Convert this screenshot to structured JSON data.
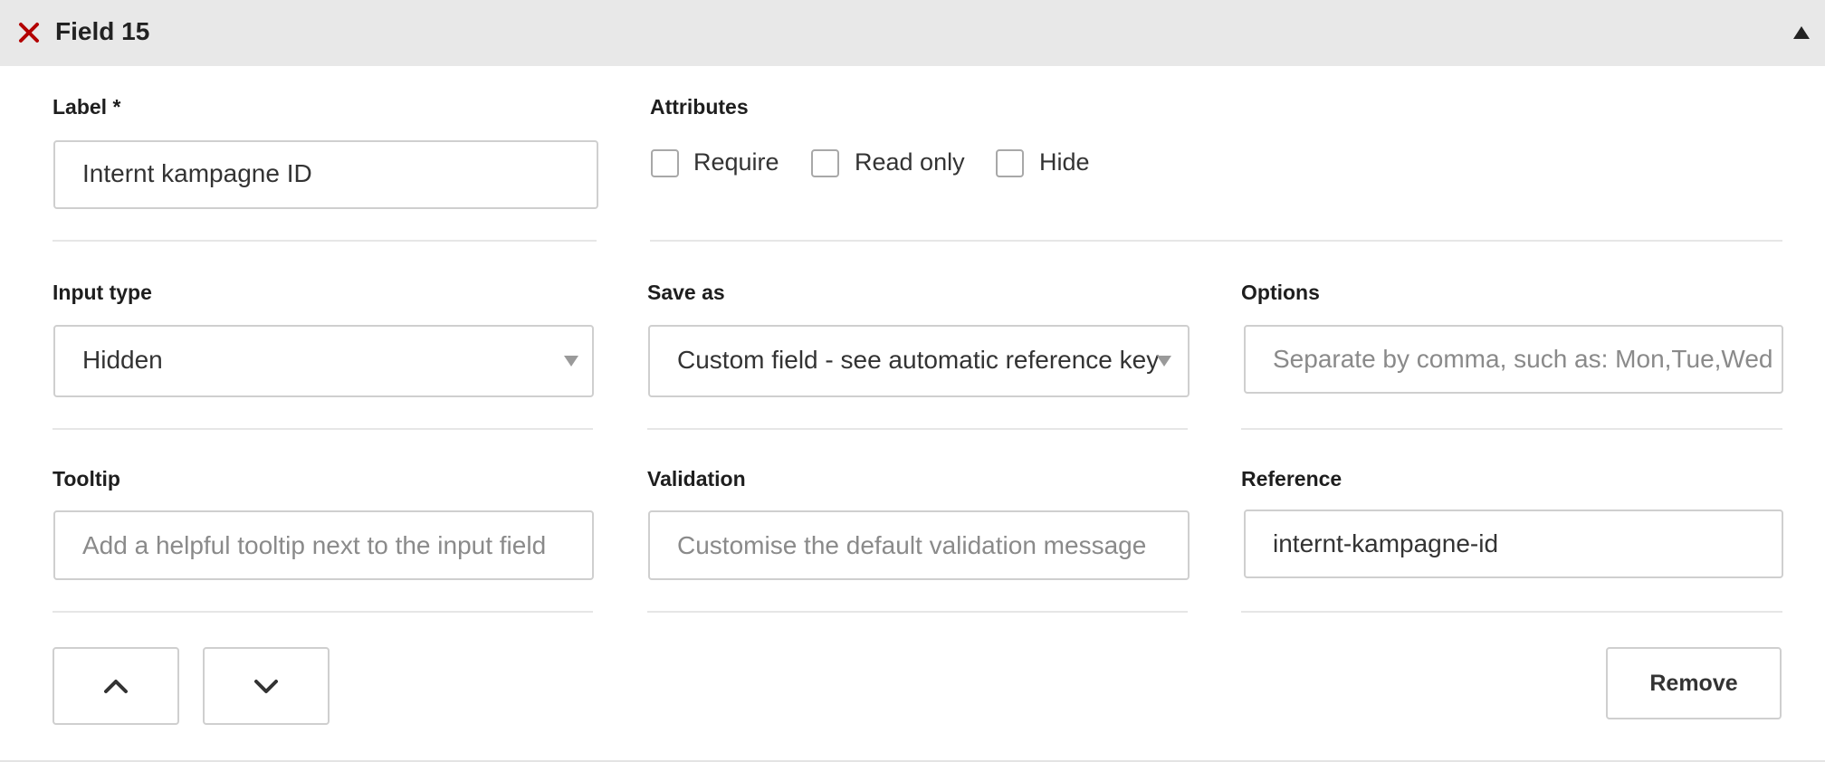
{
  "header": {
    "title": "Field 15",
    "close_icon": "close-x-icon",
    "collapse_icon": "triangle-up-icon",
    "accent_color": "#b30000"
  },
  "label_field": {
    "label": "Label *",
    "value": "Internt kampagne ID"
  },
  "attributes": {
    "label": "Attributes",
    "options": [
      {
        "label": "Require",
        "checked": false
      },
      {
        "label": "Read only",
        "checked": false
      },
      {
        "label": "Hide",
        "checked": false
      }
    ]
  },
  "input_type": {
    "label": "Input type",
    "value": "Hidden"
  },
  "save_as": {
    "label": "Save as",
    "value": "Custom field - see automatic reference key"
  },
  "options": {
    "label": "Options",
    "placeholder": "Separate by comma, such as: Mon,Tue,Wed"
  },
  "tooltip": {
    "label": "Tooltip",
    "placeholder": "Add a helpful tooltip next to the input field"
  },
  "validation": {
    "label": "Validation",
    "placeholder": "Customise the default validation message"
  },
  "reference": {
    "label": "Reference",
    "value": "internt-kampagne-id"
  },
  "actions": {
    "move_up_icon": "chevron-up-icon",
    "move_down_icon": "chevron-down-icon",
    "remove_label": "Remove"
  }
}
